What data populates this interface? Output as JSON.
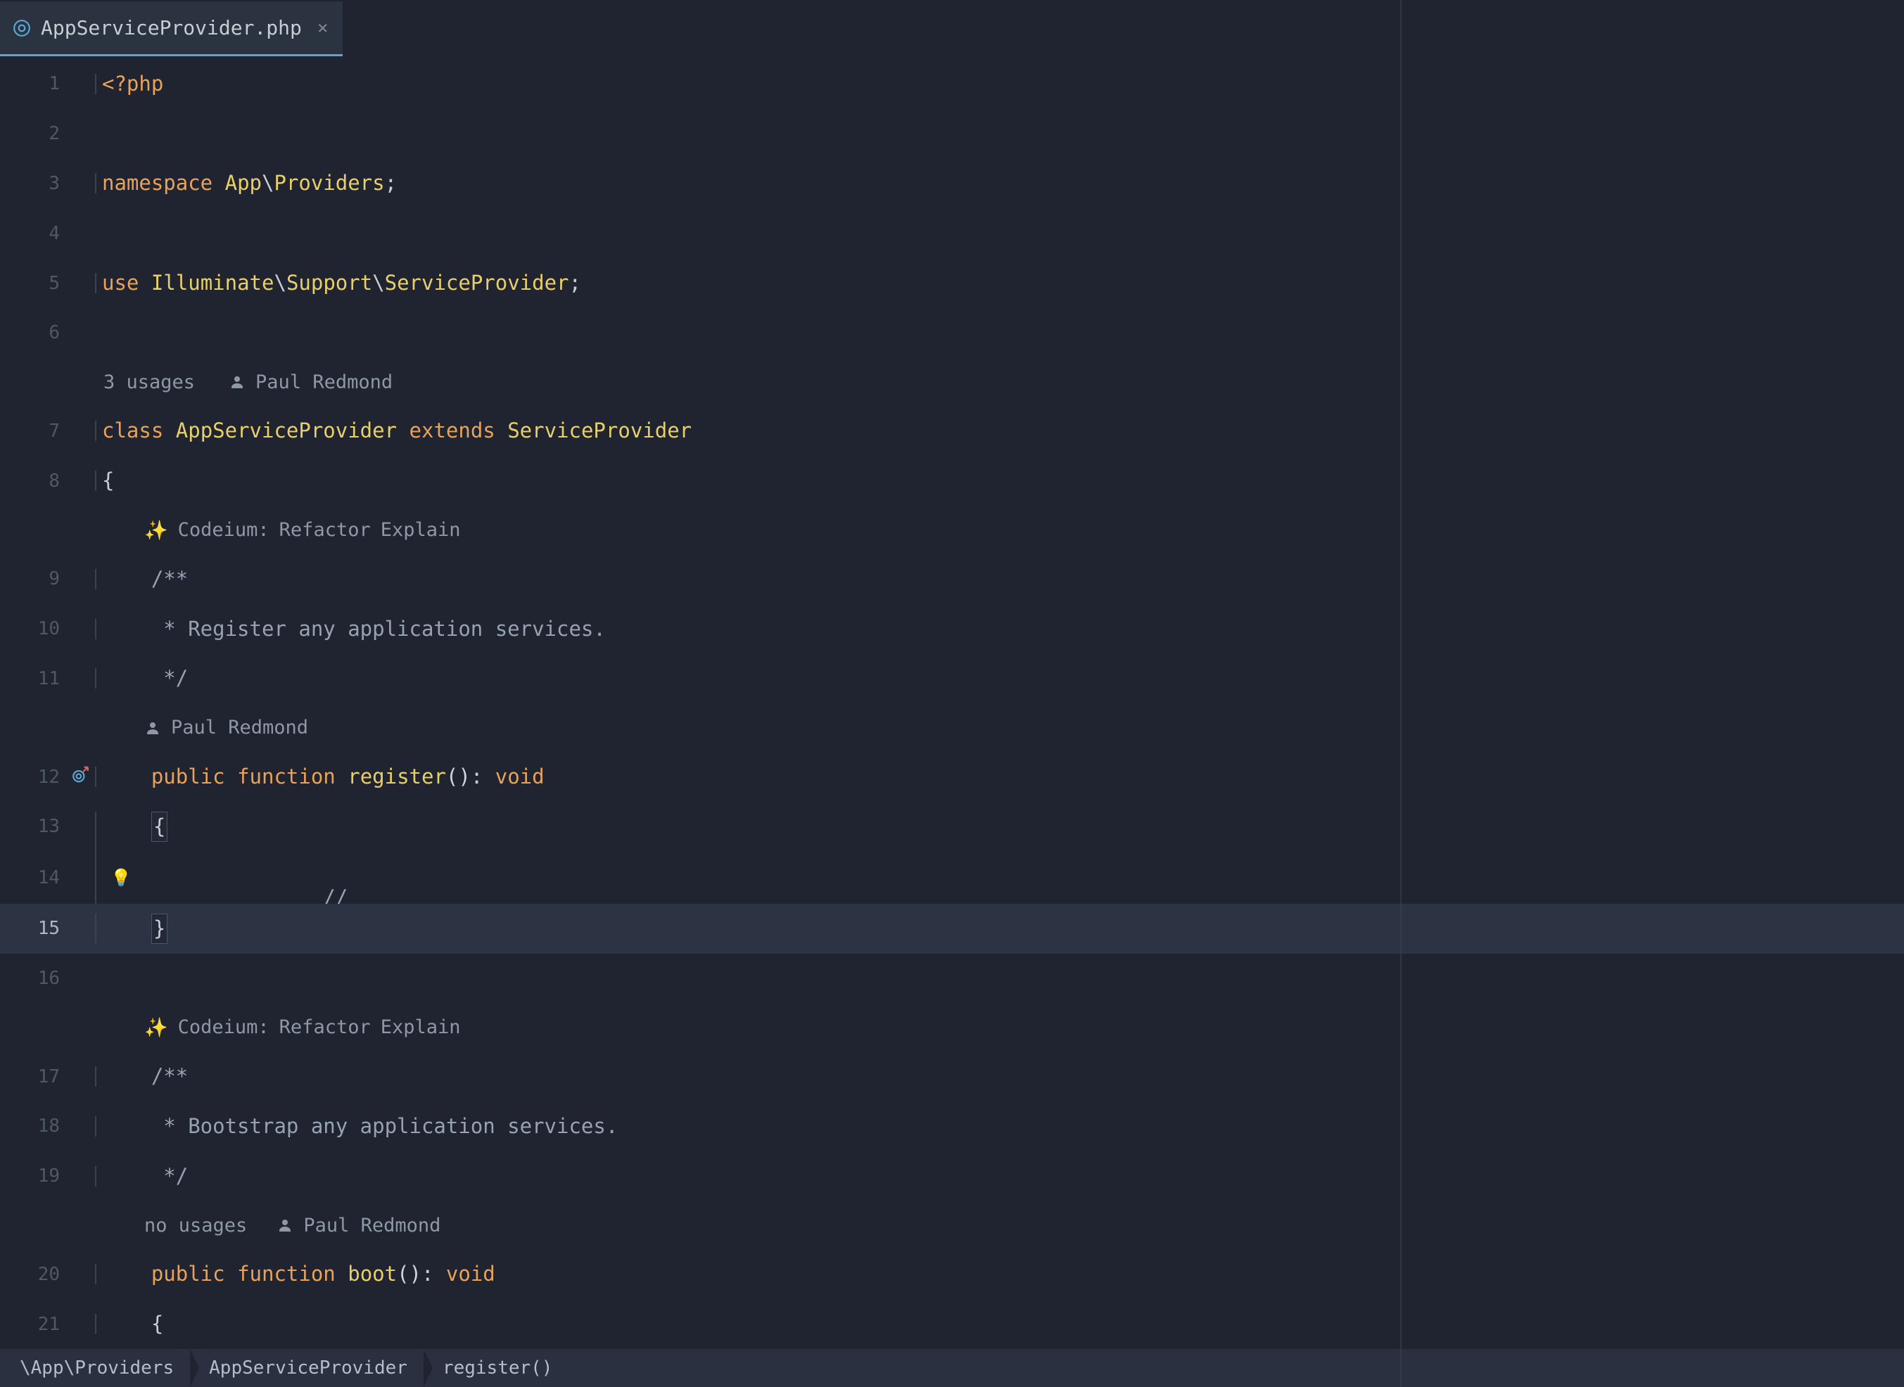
{
  "tab": {
    "filename": "AppServiceProvider.php",
    "close_glyph": "×"
  },
  "editor": {
    "lines": {
      "l1": {
        "num": "1"
      },
      "l2": {
        "num": "2"
      },
      "l3": {
        "num": "3"
      },
      "l4": {
        "num": "4"
      },
      "l5": {
        "num": "5"
      },
      "l6": {
        "num": "6"
      },
      "l7": {
        "num": "7"
      },
      "l8": {
        "num": "8"
      },
      "l9": {
        "num": "9"
      },
      "l10": {
        "num": "10"
      },
      "l11": {
        "num": "11"
      },
      "l12": {
        "num": "12"
      },
      "l13": {
        "num": "13"
      },
      "l14": {
        "num": "14"
      },
      "l15": {
        "num": "15"
      },
      "l16": {
        "num": "16"
      },
      "l17": {
        "num": "17"
      },
      "l18": {
        "num": "18"
      },
      "l19": {
        "num": "19"
      },
      "l20": {
        "num": "20"
      },
      "l21": {
        "num": "21"
      }
    },
    "tokens": {
      "php_open": "<?php",
      "namespace_kw": "namespace",
      "app": "App",
      "providers": "Providers",
      "use_kw": "use",
      "illuminate": "Illuminate",
      "support": "Support",
      "serviceprovider": "ServiceProvider",
      "class_kw": "class",
      "appserviceprovider": "AppServiceProvider",
      "extends_kw": "extends",
      "open_brace": "{",
      "close_brace": "}",
      "doc9": "/**",
      "doc10": " * Register any application services.",
      "doc11": " */",
      "public_kw": "public",
      "function_kw": "function",
      "register_fn": "register",
      "boot_fn": "boot",
      "parens": "()",
      "colon_void": ": ",
      "void_kw": "void",
      "comment_slashes": "//",
      "doc17": "/**",
      "doc18": " * Bootstrap any application services.",
      "doc19": " */",
      "bs": "\\",
      "semi": ";"
    },
    "lens": {
      "class_usages": "3 usages",
      "author": "Paul Redmond",
      "codeium_prefix": "Codeium:",
      "refactor": "Refactor",
      "explain": "Explain",
      "boot_usages": "no usages",
      "sparkle": "✨"
    }
  },
  "breadcrumb": {
    "c1": "\\App\\Providers",
    "c2": "AppServiceProvider",
    "c3": "register()"
  }
}
